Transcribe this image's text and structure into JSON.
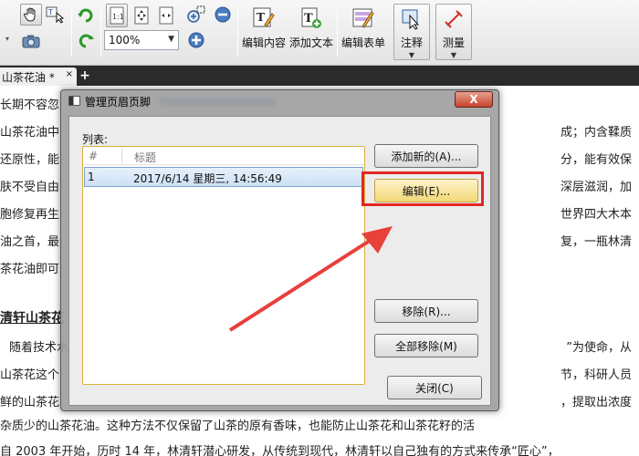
{
  "toolbar": {
    "zoom_value": "100%",
    "buttons": {
      "edit_content": "编辑内容",
      "add_text": "添加文本",
      "edit_form": "编辑表单",
      "annotate": "注释",
      "measure": "测量"
    },
    "icons": [
      "hand-icon",
      "select-text-icon",
      "camera-icon",
      "rotate-cw-icon",
      "rotate-ccw-icon",
      "actual-size-icon",
      "fit-page-icon",
      "fit-width-icon",
      "zoom-in-marquee-icon",
      "zoom-out-icon",
      "zoom-in-icon"
    ]
  },
  "tab": {
    "title": "山茶花油 *",
    "close": "×",
    "new": "+"
  },
  "document": {
    "lines_left": [
      "长期不容忽",
      "山茶花油中",
      "还原性，能",
      "肤不受自由",
      "胞修复再生",
      "油之首，最",
      "茶花油即可"
    ],
    "lines_right": [
      "成；内含鞣质",
      "分，能有效保",
      "深层滋润，加",
      "世界四大木本",
      "复，一瓶林清"
    ],
    "heading": "清轩山茶花",
    "para2_left": [
      "随着技术水",
      "山茶花这个",
      "鲜的山茶花"
    ],
    "para2_right": [
      "”为使命，从",
      "节，科研人员",
      "，提取出浓度"
    ],
    "line_bottom1": "杂质少的山茶花油。这种方法不仅保留了山茶的原有香味，也能防止山茶花和山茶花籽的活",
    "line_bottom2": "自 2003 年开始，历时 14 年，林清轩潜心研发，从传统到现代，林清轩以自己独有的方式来传承“匠心”，"
  },
  "dialog": {
    "title": "管理页眉页脚",
    "close_label": "X",
    "list_label": "列表:",
    "columns": [
      "#",
      "标题"
    ],
    "rows": [
      {
        "num": "1",
        "title": "2017/6/14 星期三, 14:56:49"
      }
    ],
    "buttons": {
      "add_new": "添加新的(A)...",
      "edit": "编辑(E)...",
      "remove": "移除(R)...",
      "remove_all": "全部移除(M)",
      "close": "关闭(C)"
    }
  },
  "colors": {
    "highlight_box": "#e32626",
    "arrow": "#e8403a",
    "focused_button": "#f2d878",
    "selected_row": "#cde0f5"
  }
}
